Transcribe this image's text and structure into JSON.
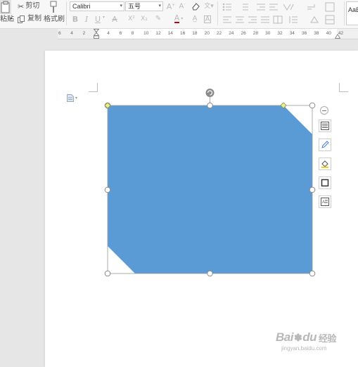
{
  "ribbon": {
    "paste_label": "粘贴",
    "cut_label": "剪切",
    "copy_label": "复制",
    "format_painter_label": "格式刷",
    "font_name": "Calibri",
    "font_size": "五号",
    "style_preview": "AaB",
    "bold": "B",
    "italic": "I",
    "underline": "U",
    "strike": "A",
    "superscript": "X²",
    "subscript": "X₂",
    "font_color": "A"
  },
  "ruler": {
    "ticks": [
      "6",
      "4",
      "2",
      "2",
      "4",
      "6",
      "8",
      "10",
      "12",
      "14",
      "16",
      "18",
      "20",
      "22",
      "24",
      "26",
      "28",
      "30",
      "32",
      "34",
      "36",
      "38",
      "40",
      "42"
    ]
  },
  "watermark": {
    "brand": "Bai",
    "brand2": "du",
    "brand_cn": "经验",
    "url": "jingyan.baidu.com"
  },
  "colors": {
    "shape_fill": "#5b9bd5",
    "adjust_handle": "#e8f08a"
  }
}
